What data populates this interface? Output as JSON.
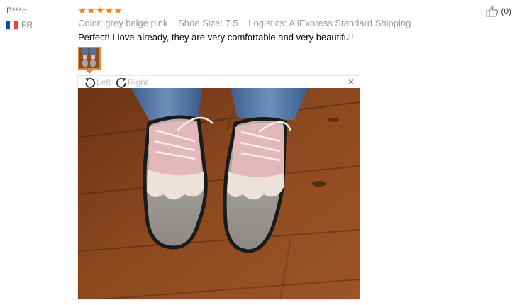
{
  "user": {
    "name": "P***n",
    "country": "FR"
  },
  "review": {
    "rating": 5,
    "color": "Color: grey beige pink",
    "shoe_size": "Shoe Size: 7.5",
    "logistics": "Logistics: AliExpress Standard Shipping",
    "text": "Perfect! I love already, they are very comfortable and very beautiful!"
  },
  "helpful": {
    "count": "(0)"
  },
  "viewer": {
    "rotate_left": "Left",
    "rotate_right": "Right",
    "close": "×"
  },
  "colors": {
    "link": "#2e6db4",
    "star": "#ff7b00",
    "accent": "#e6843a",
    "muted": "#999999"
  }
}
